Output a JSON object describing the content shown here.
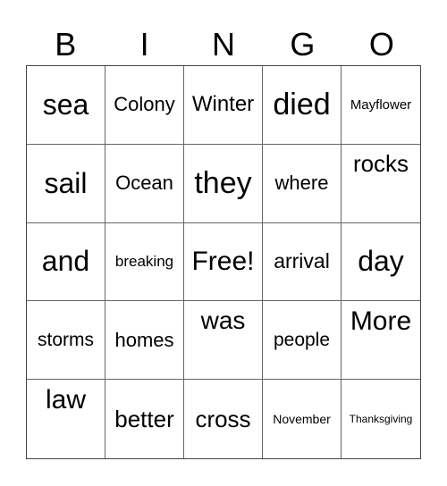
{
  "header": [
    "B",
    "I",
    "N",
    "G",
    "O"
  ],
  "cells": [
    {
      "text": "sea",
      "size": 32
    },
    {
      "text": "Colony",
      "size": 22
    },
    {
      "text": "Winter",
      "size": 24
    },
    {
      "text": "died",
      "size": 34
    },
    {
      "text": "Mayflower",
      "size": 15
    },
    {
      "text": "sail",
      "size": 32
    },
    {
      "text": "Ocean",
      "size": 22
    },
    {
      "text": "they",
      "size": 34
    },
    {
      "text": "where",
      "size": 22
    },
    {
      "text": "rocks",
      "size": 26,
      "top": true
    },
    {
      "text": "and",
      "size": 32
    },
    {
      "text": "breaking",
      "size": 17
    },
    {
      "text": "Free!",
      "size": 30
    },
    {
      "text": "arrival",
      "size": 23
    },
    {
      "text": "day",
      "size": 32
    },
    {
      "text": "storms",
      "size": 21
    },
    {
      "text": "homes",
      "size": 22
    },
    {
      "text": "was",
      "size": 28,
      "top": true
    },
    {
      "text": "people",
      "size": 21
    },
    {
      "text": "More",
      "size": 30,
      "top": true
    },
    {
      "text": "law",
      "size": 30,
      "top": true
    },
    {
      "text": "better",
      "size": 26
    },
    {
      "text": "cross",
      "size": 26
    },
    {
      "text": "November",
      "size": 14
    },
    {
      "text": "Thanksgiving",
      "size": 12
    }
  ]
}
